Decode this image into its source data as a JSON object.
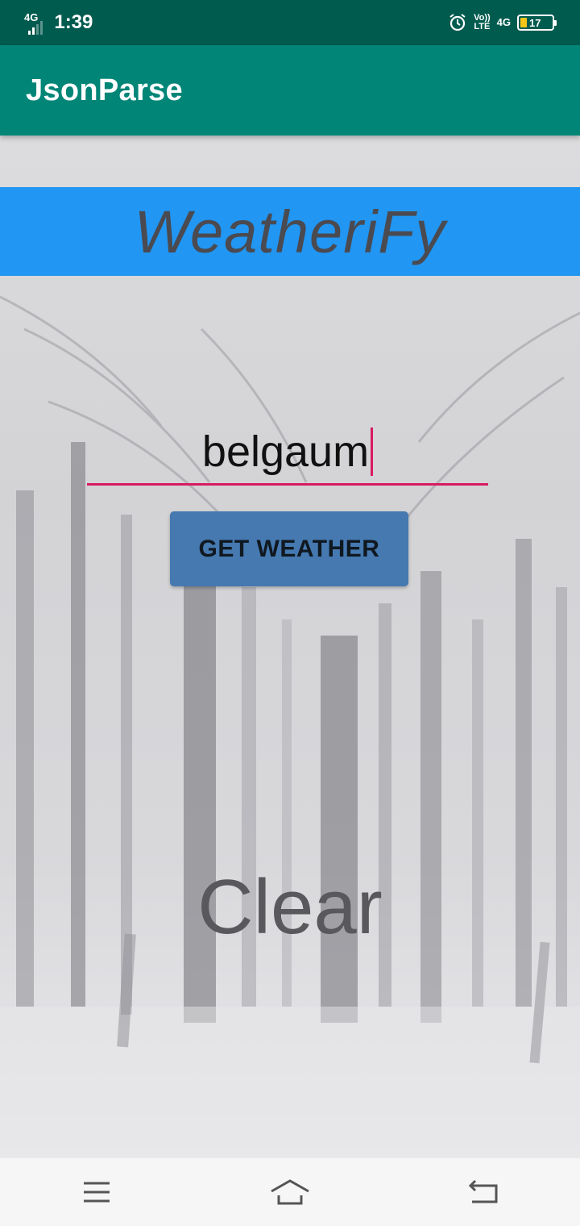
{
  "status_bar": {
    "network_type": "4G",
    "time": "1:39",
    "volte_top": "Vo))",
    "volte_bottom": "LTE",
    "network_type_right": "4G",
    "battery_level": "17",
    "icons": [
      "signal-icon",
      "alarm-icon",
      "battery-icon"
    ]
  },
  "app_bar": {
    "title": "JsonParse"
  },
  "banner": {
    "title": "WeatheriFy"
  },
  "search": {
    "city_value": "belgaum"
  },
  "actions": {
    "get_weather_label": "GET WEATHER"
  },
  "result": {
    "condition": "Clear"
  },
  "nav_bar": {
    "icons": [
      "menu-icon",
      "home-icon",
      "back-icon"
    ]
  },
  "colors": {
    "status_bar": "#005b4f",
    "app_bar": "#008577",
    "banner": "#2196f3",
    "accent": "#d81b60",
    "button": "#4579b0"
  }
}
